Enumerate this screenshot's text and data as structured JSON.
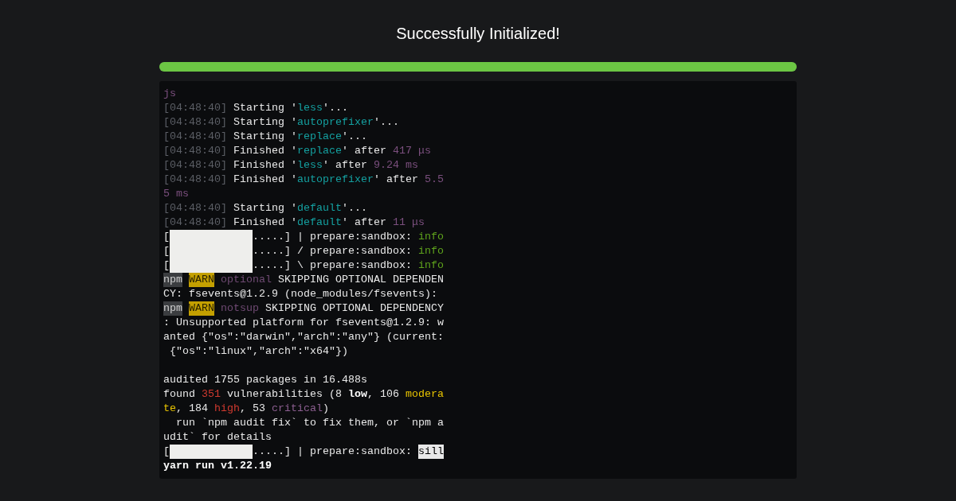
{
  "title": "Successfully Initialized!",
  "progress": {
    "level": 1
  },
  "terminal": {
    "lines": [
      {
        "segments": [
          {
            "kind": "module",
            "text": "js"
          }
        ]
      },
      {
        "segments": [
          {
            "kind": "time",
            "text": "[04:48:40]"
          },
          {
            "kind": "plain",
            "text": " Starting '"
          },
          {
            "kind": "task",
            "text": "less"
          },
          {
            "kind": "plain",
            "text": "'..."
          }
        ]
      },
      {
        "segments": [
          {
            "kind": "time",
            "text": "[04:48:40]"
          },
          {
            "kind": "plain",
            "text": " Starting '"
          },
          {
            "kind": "task",
            "text": "autoprefixer"
          },
          {
            "kind": "plain",
            "text": "'..."
          }
        ]
      },
      {
        "segments": [
          {
            "kind": "time",
            "text": "[04:48:40]"
          },
          {
            "kind": "plain",
            "text": " Starting '"
          },
          {
            "kind": "task",
            "text": "replace"
          },
          {
            "kind": "plain",
            "text": "'..."
          }
        ]
      },
      {
        "segments": [
          {
            "kind": "time",
            "text": "[04:48:40]"
          },
          {
            "kind": "plain",
            "text": " Finished '"
          },
          {
            "kind": "task",
            "text": "replace"
          },
          {
            "kind": "plain",
            "text": "' after "
          },
          {
            "kind": "duration",
            "text": "417 μs"
          }
        ]
      },
      {
        "segments": [
          {
            "kind": "time",
            "text": "[04:48:40]"
          },
          {
            "kind": "plain",
            "text": " Finished '"
          },
          {
            "kind": "task",
            "text": "less"
          },
          {
            "kind": "plain",
            "text": "' after "
          },
          {
            "kind": "duration",
            "text": "9.24 ms"
          }
        ]
      },
      {
        "segments": [
          {
            "kind": "time",
            "text": "[04:48:40]"
          },
          {
            "kind": "plain",
            "text": " Finished '"
          },
          {
            "kind": "task",
            "text": "autoprefixer"
          },
          {
            "kind": "plain",
            "text": "' after "
          },
          {
            "kind": "duration",
            "text": "5.5"
          }
        ]
      },
      {
        "segments": [
          {
            "kind": "duration",
            "text": "5 ms"
          }
        ]
      },
      {
        "segments": [
          {
            "kind": "time",
            "text": "[04:48:40]"
          },
          {
            "kind": "plain",
            "text": " Starting '"
          },
          {
            "kind": "task",
            "text": "default"
          },
          {
            "kind": "plain",
            "text": "'..."
          }
        ]
      },
      {
        "segments": [
          {
            "kind": "time",
            "text": "[04:48:40]"
          },
          {
            "kind": "plain",
            "text": " Finished '"
          },
          {
            "kind": "task",
            "text": "default"
          },
          {
            "kind": "plain",
            "text": "' after "
          },
          {
            "kind": "duration",
            "text": "11 μs"
          }
        ]
      },
      {
        "segments": [
          {
            "kind": "plain",
            "text": "["
          },
          {
            "kind": "gauge"
          },
          {
            "kind": "plain",
            "text": ".....] | prepare:sandbox: "
          },
          {
            "kind": "info",
            "text": "info"
          }
        ]
      },
      {
        "segments": [
          {
            "kind": "plain",
            "text": "["
          },
          {
            "kind": "gauge"
          },
          {
            "kind": "plain",
            "text": ".....] / prepare:sandbox: "
          },
          {
            "kind": "info",
            "text": "info"
          }
        ]
      },
      {
        "segments": [
          {
            "kind": "plain",
            "text": "["
          },
          {
            "kind": "gauge"
          },
          {
            "kind": "plain",
            "text": ".....] \\ prepare:sandbox: "
          },
          {
            "kind": "info",
            "text": "info"
          }
        ]
      },
      {
        "segments": [
          {
            "kind": "npm",
            "text": "npm"
          },
          {
            "kind": "warn",
            "text": "WARN"
          },
          {
            "kind": "tag",
            "text": " optional"
          },
          {
            "kind": "plain",
            "text": " SKIPPING OPTIONAL DEPENDEN"
          }
        ]
      },
      {
        "segments": [
          {
            "kind": "plain",
            "text": "CY: fsevents@1.2.9 (node_modules/fsevents):"
          }
        ]
      },
      {
        "segments": [
          {
            "kind": "npm",
            "text": "npm"
          },
          {
            "kind": "warn",
            "text": "WARN"
          },
          {
            "kind": "tag",
            "text": " notsup"
          },
          {
            "kind": "plain",
            "text": " SKIPPING OPTIONAL DEPENDENCY"
          }
        ]
      },
      {
        "segments": [
          {
            "kind": "plain",
            "text": ": Unsupported platform for fsevents@1.2.9: w"
          }
        ]
      },
      {
        "segments": [
          {
            "kind": "plain",
            "text": "anted {\"os\":\"darwin\",\"arch\":\"any\"} (current:"
          }
        ]
      },
      {
        "segments": [
          {
            "kind": "plain",
            "text": " {\"os\":\"linux\",\"arch\":\"x64\"})"
          }
        ]
      },
      {
        "gap_before": true,
        "segments": [
          {
            "kind": "plain",
            "text": "audited 1755 packages in 16.488s"
          }
        ]
      },
      {
        "segments": [
          {
            "kind": "plain",
            "text": "found "
          },
          {
            "kind": "red",
            "text": "351"
          },
          {
            "kind": "plain",
            "text": " vulnerabilities (8 "
          },
          {
            "kind": "bold",
            "text": "low"
          },
          {
            "kind": "plain",
            "text": ", 106 "
          },
          {
            "kind": "yellow",
            "text": "modera"
          }
        ]
      },
      {
        "segments": [
          {
            "kind": "yellow",
            "text": "te"
          },
          {
            "kind": "plain",
            "text": ", 184 "
          },
          {
            "kind": "red",
            "text": "high"
          },
          {
            "kind": "plain",
            "text": ", 53 "
          },
          {
            "kind": "critical",
            "text": "critical"
          },
          {
            "kind": "plain",
            "text": ")"
          }
        ]
      },
      {
        "segments": [
          {
            "kind": "plain",
            "text": "  run `npm audit fix` to fix them, or `npm a"
          }
        ]
      },
      {
        "segments": [
          {
            "kind": "plain",
            "text": "udit` for details"
          }
        ]
      },
      {
        "segments": [
          {
            "kind": "plain",
            "text": "["
          },
          {
            "kind": "gauge"
          },
          {
            "kind": "plain",
            "text": ".....] | prepare:sandbox: "
          },
          {
            "kind": "sill",
            "text": "sill"
          }
        ]
      },
      {
        "segments": [
          {
            "kind": "bold",
            "text": "yarn run v1.22.19"
          }
        ]
      }
    ]
  }
}
